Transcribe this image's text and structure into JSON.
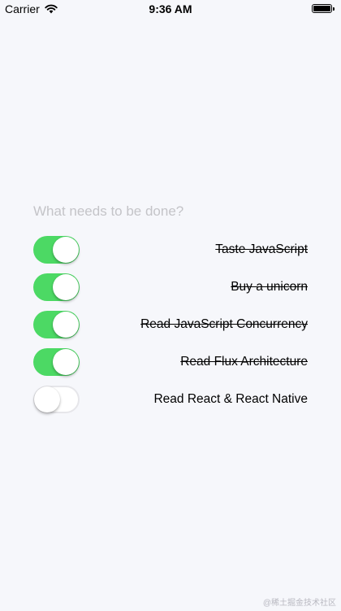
{
  "status_bar": {
    "carrier": "Carrier",
    "time": "9:36 AM"
  },
  "input": {
    "placeholder": "What needs to be done?",
    "value": ""
  },
  "todos": [
    {
      "text": "Taste JavaScript",
      "completed": true
    },
    {
      "text": "Buy a unicorn",
      "completed": true
    },
    {
      "text": "Read JavaScript Concurrency",
      "completed": true
    },
    {
      "text": "Read Flux Architecture",
      "completed": true
    },
    {
      "text": "Read React & React Native",
      "completed": false
    }
  ],
  "watermark": "@稀土掘金技术社区",
  "colors": {
    "background": "#f6f7fb",
    "toggle_on": "#4cd964",
    "toggle_off_border": "#e6e6ea",
    "placeholder": "#c4c4c8"
  }
}
